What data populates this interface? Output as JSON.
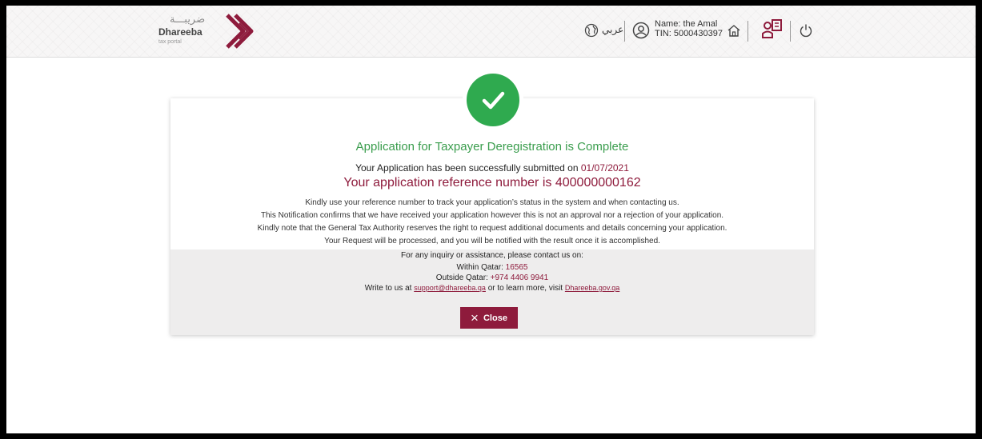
{
  "header": {
    "logo_arabic": "ضريبـــة",
    "logo_name": "Dhareeba",
    "logo_sub": "tax portal",
    "language_toggle": "عربي",
    "user_name": "Name: the Amal",
    "user_tin": "TIN: 5000430397",
    "icons": [
      "globe-icon",
      "user-icon",
      "home-icon",
      "tax-services-icon",
      "power-icon"
    ]
  },
  "confirmation": {
    "title": "Application for Taxpayer Deregistration is Complete",
    "submitted_text": "Your Application has been successfully submitted on",
    "submitted_date": "01/07/2021",
    "reference_text": "Your application reference number is",
    "reference_number": "400000000162",
    "messages": [
      "Kindly use your reference number to track your application’s status in the system and when contacting us.",
      "This Notification confirms that we have received your application however this is not an approval nor a rejection of your application.",
      "Kindly note that the General Tax Authority reserves the right to request additional documents and details concerning your application.",
      "Your Request will be processed, and you will be notified with the result once it is accomplished."
    ]
  },
  "contact": {
    "heading": "For any inquiry or assistance, please contact us on:",
    "within_label": "Within Qatar:",
    "within_number": "16565",
    "outside_label": "Outside Qatar:",
    "outside_number": "+974 4406 9941",
    "write_prefix": "Write to us at",
    "email": "support@dhareeba.qa",
    "write_middle": "or to learn more, visit",
    "website": "Dhareeba.gov.qa"
  },
  "close_button": {
    "icon": "×",
    "label": "Close"
  },
  "colors": {
    "brand": "#8e1b3c",
    "success": "#2faa4f",
    "success_text": "#3a9d4d"
  }
}
